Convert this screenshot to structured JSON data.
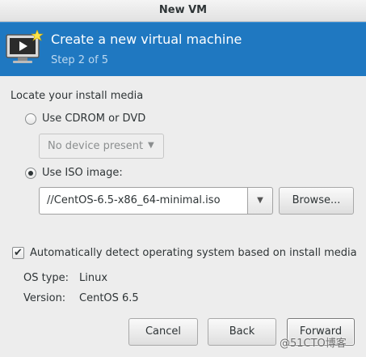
{
  "window": {
    "title": "New VM"
  },
  "header": {
    "title": "Create a new virtual machine",
    "step": "Step 2 of 5",
    "icon": "virtual-machine-icon"
  },
  "media": {
    "section_label": "Locate your install media",
    "cdrom_label": "Use CDROM or DVD",
    "cdrom_selected": false,
    "device_placeholder": "No device present",
    "iso_label": "Use ISO image:",
    "iso_selected": true,
    "iso_path": "//CentOS-6.5-x86_64-minimal.iso",
    "browse_label": "Browse..."
  },
  "detect": {
    "checked": true,
    "label": "Automatically detect operating system based on install media",
    "os_type_label": "OS type:",
    "os_type_value": "Linux",
    "version_label": "Version:",
    "version_value": "CentOS 6.5"
  },
  "buttons": {
    "cancel": "Cancel",
    "back": "Back",
    "forward": "Forward"
  },
  "watermark": "@51CTO博客",
  "colors": {
    "header_bg": "#1f78c1",
    "window_bg": "#ededed"
  }
}
